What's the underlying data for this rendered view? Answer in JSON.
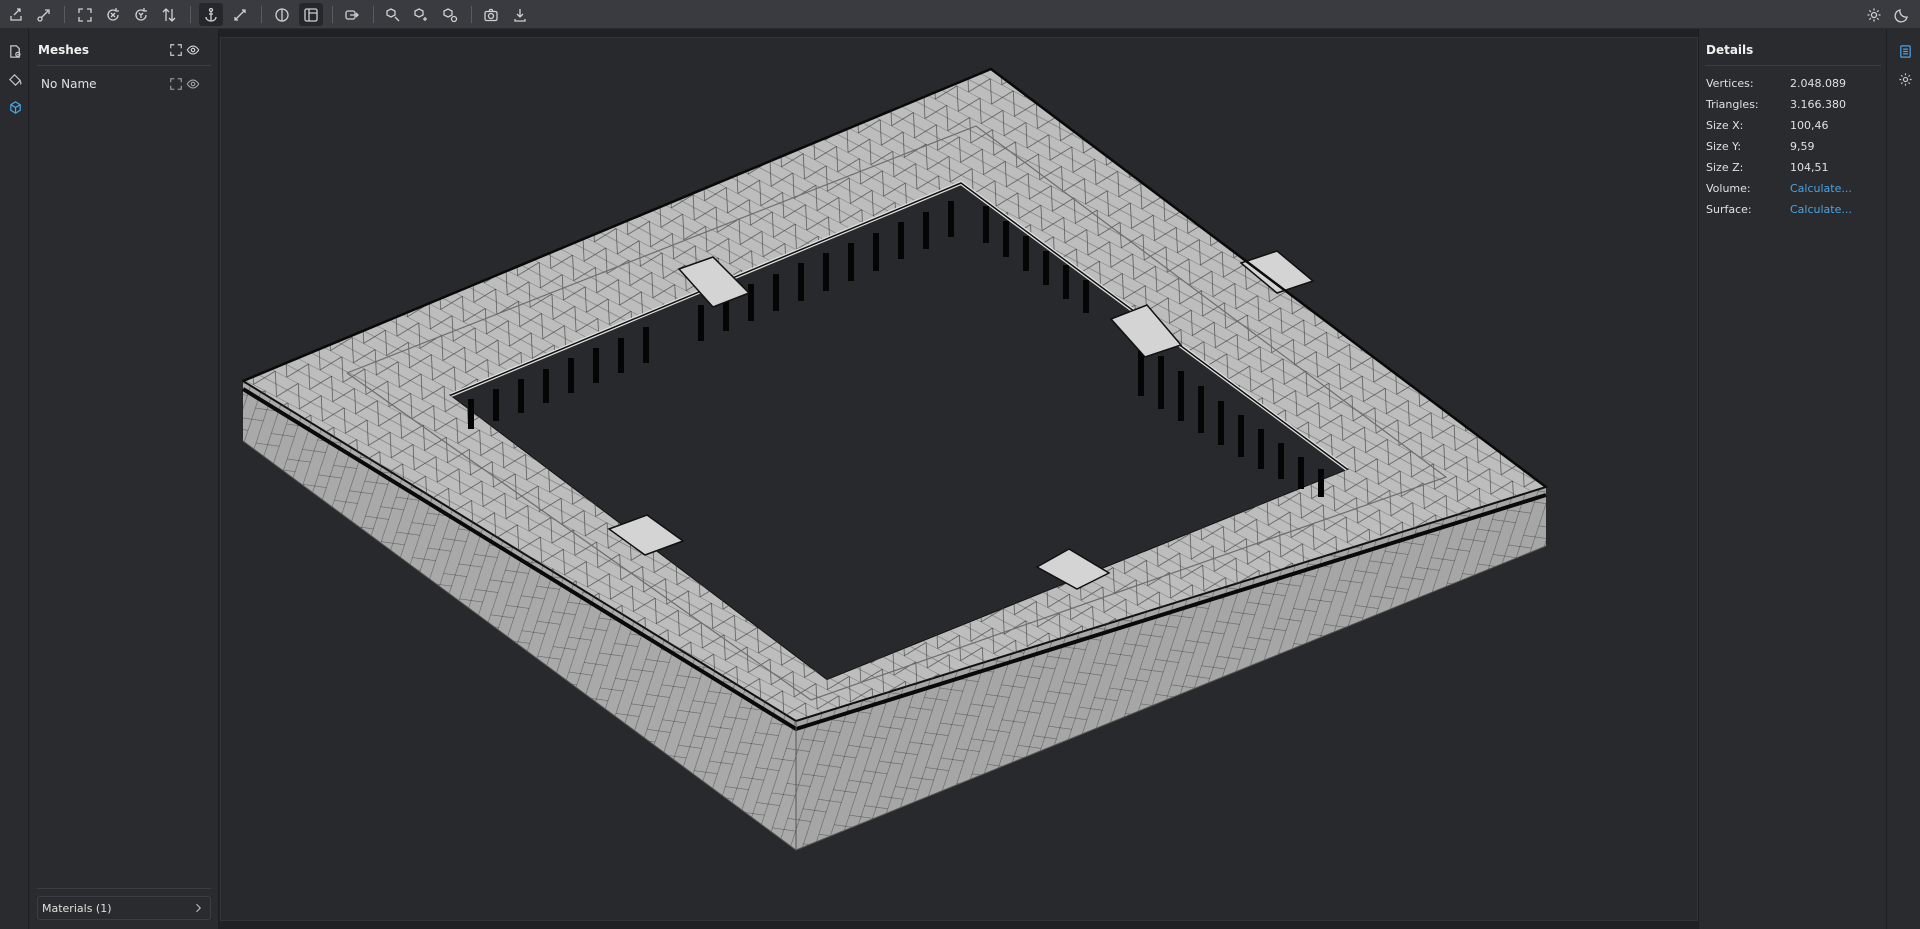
{
  "toolbar": {
    "left_icons": [
      "import-icon",
      "export-icon",
      "fit-view-icon",
      "rotate-x-icon",
      "rotate-y-icon",
      "flip-axis-icon",
      "anchor-icon",
      "measure-icon",
      "half-view-icon",
      "panel-view-icon",
      "clip-icon",
      "zoom-box-icon",
      "zoom-add-icon",
      "zoom-remove-icon",
      "camera-icon",
      "download-icon"
    ],
    "right_icons": [
      "sun-icon",
      "moon-icon"
    ]
  },
  "left_strip": {
    "icons": [
      "file-info-icon",
      "paint-bucket-icon",
      "cube-icon"
    ],
    "accent": "#4ba3e3"
  },
  "meshes": {
    "title": "Meshes",
    "items": [
      {
        "name": "No Name"
      }
    ],
    "materials_label": "Materials (1)"
  },
  "details": {
    "title": "Details",
    "rows": [
      {
        "key": "Vertices:",
        "value": "2.048.089"
      },
      {
        "key": "Triangles:",
        "value": "3.166.380"
      },
      {
        "key": "Size X:",
        "value": "100,46"
      },
      {
        "key": "Size Y:",
        "value": "9,59"
      },
      {
        "key": "Size Z:",
        "value": "104,51"
      },
      {
        "key": "Volume:",
        "value": "Calculate..."
      },
      {
        "key": "Surface:",
        "value": "Calculate..."
      }
    ]
  },
  "right_strip": {
    "icons": [
      "document-icon",
      "settings-icon"
    ]
  },
  "colors": {
    "background": "#202124",
    "panel": "#2a2b2f",
    "viewport": "#28292d",
    "link": "#4ba3e3",
    "mesh_fill": "#b7b7b7"
  }
}
